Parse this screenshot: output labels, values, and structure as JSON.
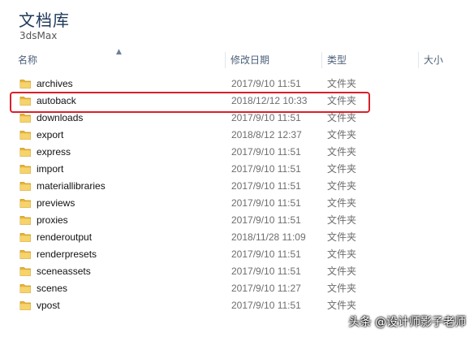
{
  "library": {
    "title": "文档库",
    "subtitle": "3dsMax"
  },
  "columns": {
    "name": "名称",
    "modified": "修改日期",
    "type": "类型",
    "size": "大小"
  },
  "files": [
    {
      "name": "archives",
      "date": "2017/9/10 11:51",
      "type": "文件夹"
    },
    {
      "name": "autoback",
      "date": "2018/12/12 10:33",
      "type": "文件夹"
    },
    {
      "name": "downloads",
      "date": "2017/9/10 11:51",
      "type": "文件夹"
    },
    {
      "name": "export",
      "date": "2018/8/12 12:37",
      "type": "文件夹"
    },
    {
      "name": "express",
      "date": "2017/9/10 11:51",
      "type": "文件夹"
    },
    {
      "name": "import",
      "date": "2017/9/10 11:51",
      "type": "文件夹"
    },
    {
      "name": "materiallibraries",
      "date": "2017/9/10 11:51",
      "type": "文件夹"
    },
    {
      "name": "previews",
      "date": "2017/9/10 11:51",
      "type": "文件夹"
    },
    {
      "name": "proxies",
      "date": "2017/9/10 11:51",
      "type": "文件夹"
    },
    {
      "name": "renderoutput",
      "date": "2018/11/28 11:09",
      "type": "文件夹"
    },
    {
      "name": "renderpresets",
      "date": "2017/9/10 11:51",
      "type": "文件夹"
    },
    {
      "name": "sceneassets",
      "date": "2017/9/10 11:51",
      "type": "文件夹"
    },
    {
      "name": "scenes",
      "date": "2017/9/10 11:27",
      "type": "文件夹"
    },
    {
      "name": "vpost",
      "date": "2017/9/10 11:51",
      "type": "文件夹"
    }
  ],
  "icons": {
    "folder": "folder-icon",
    "sort": "sort-ascending-icon"
  },
  "colors": {
    "highlight": "#d9202a",
    "folder": "#f2c94c"
  },
  "watermark": "头条 @设计师影子老师"
}
